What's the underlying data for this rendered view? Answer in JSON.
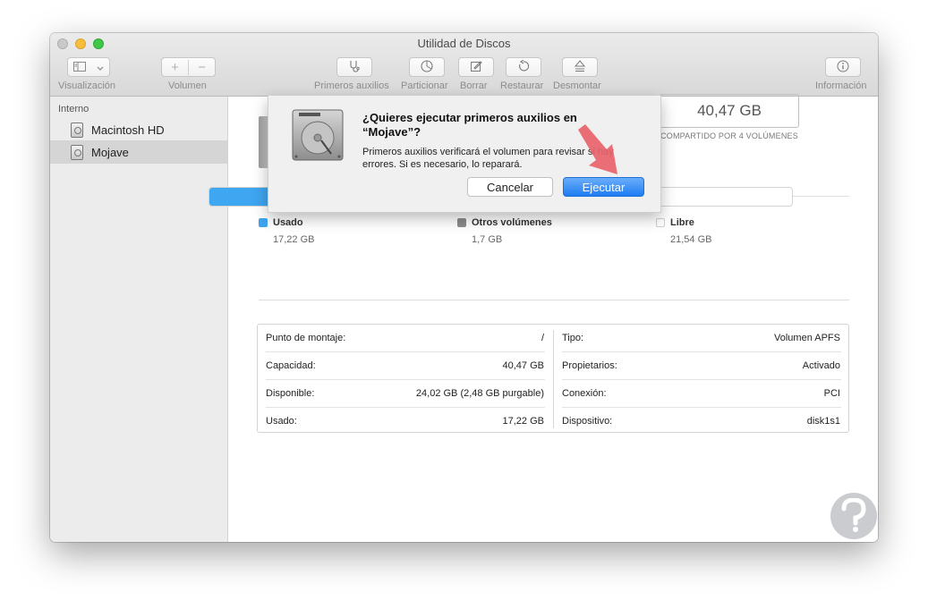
{
  "window": {
    "title": "Utilidad de Discos"
  },
  "toolbar": {
    "view_label": "Visualización",
    "volume_label": "Volumen",
    "first_aid_label": "Primeros auxilios",
    "partition_label": "Particionar",
    "erase_label": "Borrar",
    "restore_label": "Restaurar",
    "unmount_label": "Desmontar",
    "info_label": "Información"
  },
  "sidebar": {
    "section": "Interno",
    "items": [
      {
        "label": "Macintosh HD",
        "selected": false
      },
      {
        "label": "Mojave",
        "selected": true
      }
    ]
  },
  "volume": {
    "capacity": "40,47 GB",
    "shared_note": "COMPARTIDO POR 4 VOLÚMENES"
  },
  "usage": {
    "used_fraction": 0.4255,
    "other_fraction": 0.042,
    "free_fraction": 0.5325,
    "legend": [
      {
        "label": "Usado",
        "value": "17,22 GB",
        "color": "#3fa6f1"
      },
      {
        "label": "Otros volúmenes",
        "value": "1,7 GB",
        "color": "#8c8c8c"
      },
      {
        "label": "Libre",
        "value": "21,54 GB",
        "color": "#ffffff"
      }
    ]
  },
  "info": {
    "left": [
      {
        "key": "Punto de montaje:",
        "value": "/"
      },
      {
        "key": "Capacidad:",
        "value": "40,47 GB"
      },
      {
        "key": "Disponible:",
        "value": "24,02 GB (2,48 GB purgable)"
      },
      {
        "key": "Usado:",
        "value": "17,22 GB"
      }
    ],
    "right": [
      {
        "key": "Tipo:",
        "value": "Volumen APFS"
      },
      {
        "key": "Propietarios:",
        "value": "Activado"
      },
      {
        "key": "Conexión:",
        "value": "PCI"
      },
      {
        "key": "Dispositivo:",
        "value": "disk1s1"
      }
    ]
  },
  "dialog": {
    "title": "¿Quieres ejecutar primeros auxilios en “Mojave”?",
    "message": "Primeros auxilios verificará el volumen para revisar si hay errores. Si es necesario, lo reparará.",
    "cancel_label": "Cancelar",
    "run_label": "Ejecutar"
  },
  "colors": {
    "accent": "#1f7cf2",
    "used": "#3fa6f1",
    "other": "#8c8c8c",
    "arrow": "#e8636a"
  }
}
